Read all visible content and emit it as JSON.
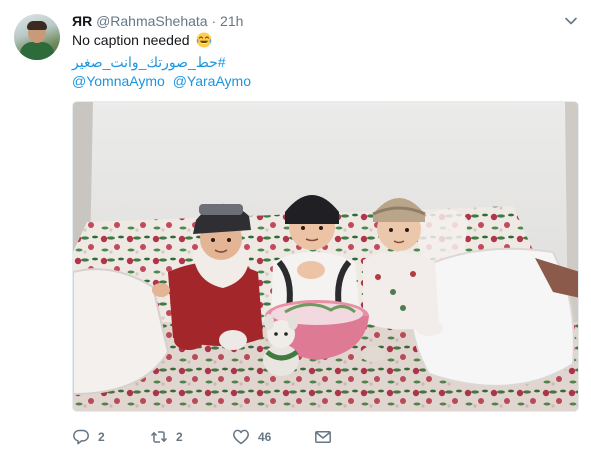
{
  "tweet": {
    "display_name": "ЯR",
    "handle": "@RahmaShehata",
    "separator": "·",
    "time": "21h",
    "text": "No caption needed",
    "emoji": "tears-of-joy-emoji",
    "hashtag": "#حط_صورتك_وانت_صغير",
    "mentions": [
      "@YomnaAymo",
      "@YaraAymo"
    ]
  },
  "photo": {
    "subject": "three-babies-on-floral-sofa"
  },
  "actions": {
    "reply_count": "2",
    "retweet_count": "2",
    "like_count": "46"
  },
  "colors": {
    "link": "#1b95e0",
    "muted": "#657786",
    "text": "#14171a"
  }
}
